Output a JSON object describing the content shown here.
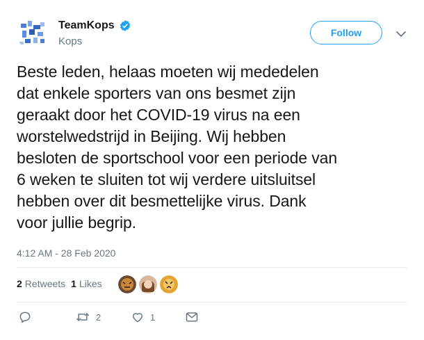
{
  "author": {
    "display_name": "TeamKops",
    "handle": "Kops",
    "verified_icon": "verified-badge-icon",
    "avatar_icon": "abstract-blue-avatar"
  },
  "follow_label": "Follow",
  "tweet": {
    "text": "Beste leden, helaas moeten wij mededelen\ndat enkele sporters van ons besmet zijn\ngeraakt door het COVID-19 virus na een\nworstelwedstrijd in Beijing. Wij hebben\nbesloten de sportschool voor een periode van\n6 weken te sluiten tot wij verdere uitsluitsel\nhebben over dit besmettelijke virus. Dank\nvoor jullie begrip.",
    "timestamp": "4:12 AM - 28 Feb 2020"
  },
  "stats": {
    "retweets_count": "2",
    "retweets_label": "Retweets",
    "likes_count": "1",
    "likes_label": "Likes"
  },
  "actions": {
    "reply_icon": "reply-icon",
    "retweet_icon": "retweet-icon",
    "retweet_count": "2",
    "like_icon": "heart-icon",
    "like_count": "1",
    "message_icon": "message-icon"
  },
  "colors": {
    "accent": "#1da1f2",
    "text": "#14171a",
    "muted": "#657786",
    "divider": "#e6ecf0"
  }
}
